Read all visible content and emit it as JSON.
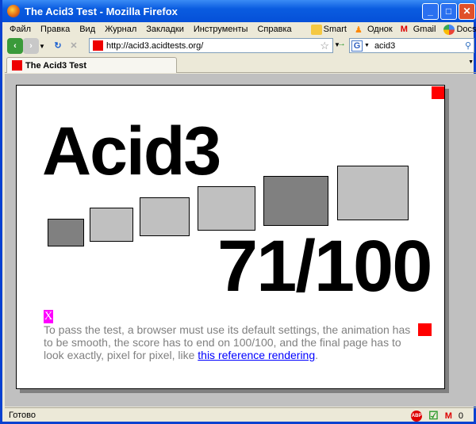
{
  "window": {
    "title": "The Acid3 Test - Mozilla Firefox"
  },
  "menu": [
    "Файл",
    "Правка",
    "Вид",
    "Журнал",
    "Закладки",
    "Инструменты",
    "Справка"
  ],
  "bookmarks": [
    {
      "label": "Smart",
      "icon": "folder-icon"
    },
    {
      "label": "Однок",
      "icon": "odnoklassniki-icon"
    },
    {
      "label": "Gmail",
      "icon": "gmail-icon"
    },
    {
      "label": "Docs",
      "icon": "google-docs-icon"
    }
  ],
  "bookmarks_overflow": "»",
  "nav": {
    "url": "http://acid3.acidtests.org/",
    "search_value": "acid3",
    "search_engine": "Google"
  },
  "tab": {
    "label": "The Acid3 Test"
  },
  "page": {
    "title": "Acid3",
    "score": "71/100",
    "x_label": "X",
    "instructions": "To pass the test, a browser must use its default settings, the animation has to be smooth, the score has to end on 100/100, and the final page has to look exactly, pixel for pixel, like ",
    "link": "this reference rendering",
    "period": ".",
    "box_colors": [
      "#808080",
      "#c0c0c0",
      "#c0c0c0",
      "#c0c0c0",
      "#808080",
      "#c0c0c0"
    ]
  },
  "status": {
    "text": "Готово",
    "gmail_count": "0"
  }
}
